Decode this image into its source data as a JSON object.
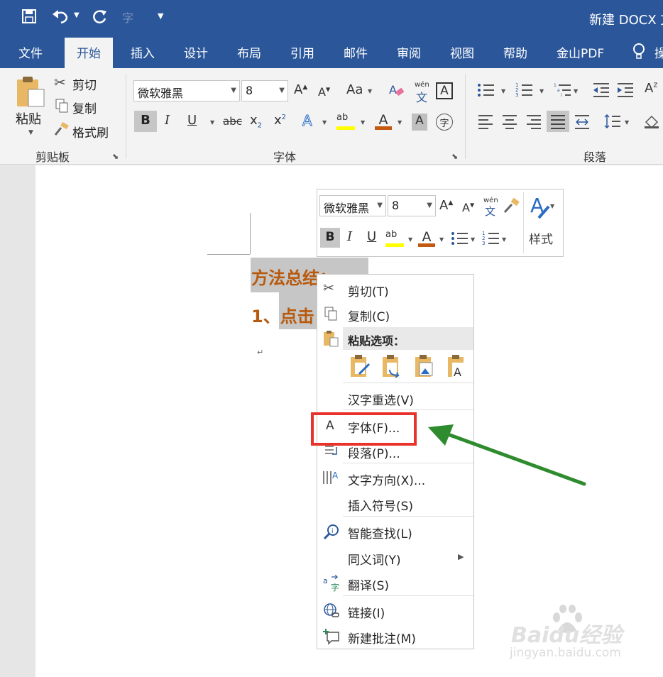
{
  "title_bar": {
    "doc_title": "新建 DOCX 文"
  },
  "tabs": [
    "文件",
    "开始",
    "插入",
    "设计",
    "布局",
    "引用",
    "邮件",
    "审阅",
    "视图",
    "帮助",
    "金山PDF",
    "操"
  ],
  "clipboard": {
    "paste": "粘贴",
    "cut": "剪切",
    "copy": "复制",
    "format_painter": "格式刷",
    "group": "剪贴板"
  },
  "font": {
    "name": "微软雅黑",
    "size": "8",
    "group": "字体",
    "case_btn": "Aa",
    "phonetic_top": "wén",
    "phonetic_bottom": "文"
  },
  "paragraph": {
    "group": "段落"
  },
  "mini_toolbar": {
    "font": "微软雅黑",
    "size": "8",
    "styles": "样式"
  },
  "document": {
    "line1": "方法总结：",
    "line2": "1、点击",
    "pilcrow": "↵"
  },
  "context_menu": {
    "cut": "剪切(T)",
    "copy": "复制(C)",
    "paste_options": "粘贴选项：",
    "reconvert": "汉字重选(V)",
    "font": "字体(F)...",
    "paragraph": "段落(P)...",
    "text_direction": "文字方向(X)...",
    "insert_symbol": "插入符号(S)",
    "smart_lookup": "智能查找(L)",
    "synonyms": "同义词(Y)",
    "translate": "翻译(S)",
    "link": "链接(I)",
    "new_comment": "新建批注(M)"
  },
  "watermark": {
    "brand": "Baidu经验",
    "url": "jingyan.baidu.com"
  },
  "colors": {
    "accent": "#2b579a",
    "highlight": "#e8322b",
    "arrow": "#2e8b2e",
    "text_orange": "#b8590d"
  }
}
